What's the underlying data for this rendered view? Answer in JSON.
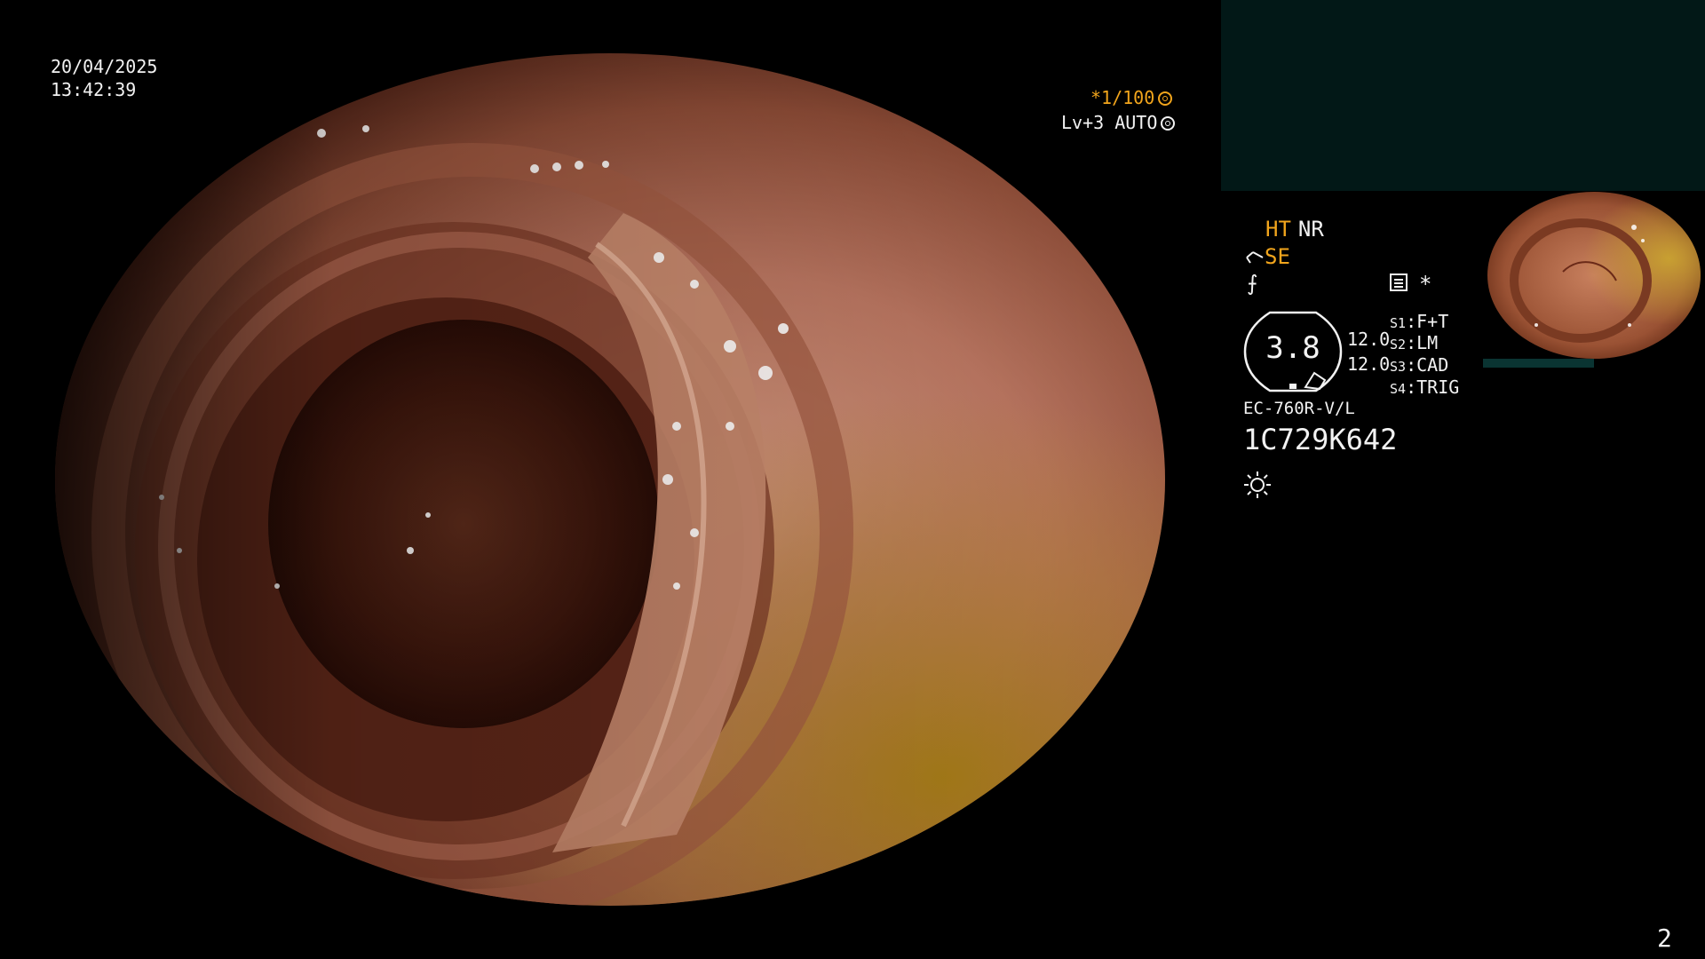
{
  "overlay": {
    "date": "20/04/2025",
    "time": "13:42:39",
    "shutter": "*1/100",
    "level": "Lv+3 AUTO",
    "page_number": "2"
  },
  "status": {
    "ht": "HT",
    "nr": "NR",
    "se": "SE",
    "freq_symbol": "⨍",
    "star": "*",
    "gauge_value": "3.8",
    "value_1": "12.0",
    "value_2": "12.0",
    "slots": [
      {
        "key": "S1",
        "value": "F+T"
      },
      {
        "key": "S2",
        "value": "LM"
      },
      {
        "key": "S3",
        "value": "CAD"
      },
      {
        "key": "S4",
        "value": "TRIG"
      }
    ],
    "model": "EC-760R-V/L",
    "serial": "1C729K642"
  },
  "colors": {
    "accent": "#f2a51c",
    "text": "#f2f2f2",
    "info_panel": "#021817",
    "tissue_dark": "#2b1009",
    "tissue_mid": "#8a4a35",
    "tissue_light": "#d49a80",
    "tissue_yellow": "#b0821e"
  },
  "icons": [
    "shutter-icon",
    "auto-iris-icon",
    "scope-icon",
    "menu-icon",
    "gauge-icon",
    "brightness-icon"
  ]
}
